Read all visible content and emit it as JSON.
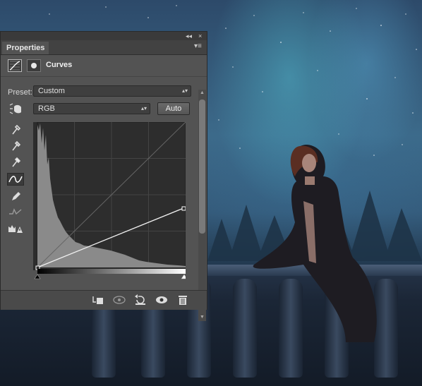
{
  "panel": {
    "tab_label": "Properties",
    "title": "Curves",
    "preset_label": "Preset:",
    "preset_value": "Custom",
    "channel_value": "RGB",
    "auto_label": "Auto",
    "collapse_glyph": "◂◂",
    "close_glyph": "×",
    "menu_glyph": "▾≡"
  },
  "tools": [
    "on-image-adjust-icon",
    "black-point-eyedropper-icon",
    "gray-point-eyedropper-icon",
    "white-point-eyedropper-icon",
    "curve-point-icon",
    "pencil-icon",
    "smooth-icon",
    "clipping-warning-icon"
  ],
  "bottom_buttons": [
    "clip-to-layer-icon",
    "view-previous-icon",
    "reset-icon",
    "visibility-eye-icon",
    "trash-icon"
  ],
  "curve": {
    "start": [
      0,
      0
    ],
    "end": [
      255,
      104
    ]
  },
  "colors": {
    "panel_bg": "#535353",
    "graph_bg": "#2d2d2d",
    "histogram": "#8a8a8a",
    "curve": "#f0f0f0"
  }
}
